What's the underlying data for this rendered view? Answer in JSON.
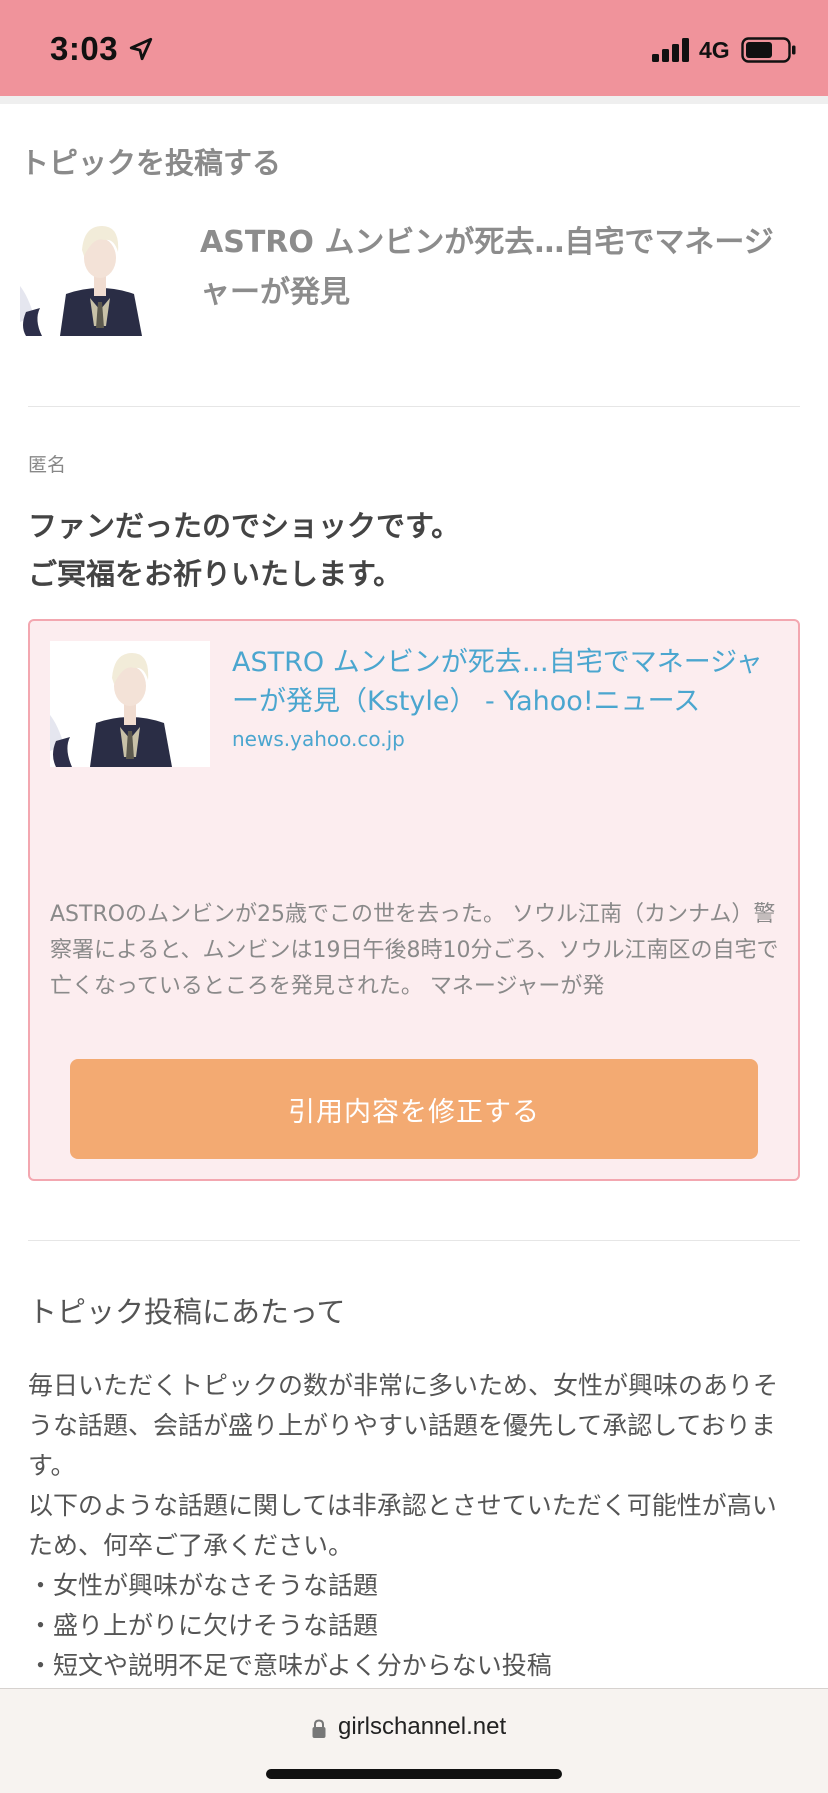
{
  "status_bar": {
    "time": "3:03",
    "network": "4G"
  },
  "page": {
    "title": "トピックを投稿する",
    "topic_title": "ASTRO ムンビンが死去…自宅でマネージャーが発見"
  },
  "comment": {
    "author": "匿名",
    "lines": [
      "ファンだったのでショックです。",
      "ご冥福をお祈りいたします。"
    ]
  },
  "quote": {
    "link_title": "ASTRO ムンビンが死去…自宅でマネージャーが発見（Kstyle） - Yahoo!ニュース",
    "domain": "news.yahoo.co.jp",
    "excerpt": "ASTROのムンビンが25歳でこの世を去った。 ソウル江南（カンナム）警察署によると、ムンビンは19日午後8時10分ごろ、ソウル江南区の自宅で亡くなっているところを発見された。 マネージャーが発",
    "edit_button_label": "引用内容を修正する"
  },
  "guidelines": {
    "heading": "トピック投稿にあたって",
    "paragraph1": "毎日いただくトピックの数が非常に多いため、女性が興味のありそうな話題、会話が盛り上がりやすい話題を優先して承認しております。",
    "paragraph2": "以下のような話題に関しては非承認とさせていただく可能性が高いため、何卒ご了承ください。",
    "items": [
      "女性が興味がなさそうな話題",
      "盛り上がりに欠けそうな話題",
      "短文や説明不足で意味がよく分からない投稿"
    ]
  },
  "browser": {
    "url": "girlschannel.net"
  },
  "colors": {
    "status_bar": "#f0939b",
    "quote_background": "#fcedef",
    "quote_border": "#f3a7b0",
    "link": "#4ba6cf",
    "button": "#f3aa72"
  },
  "icons": {
    "location": "location-arrow-icon",
    "signal": "cellular-signal-icon",
    "battery": "battery-icon",
    "lock": "lock-icon"
  }
}
